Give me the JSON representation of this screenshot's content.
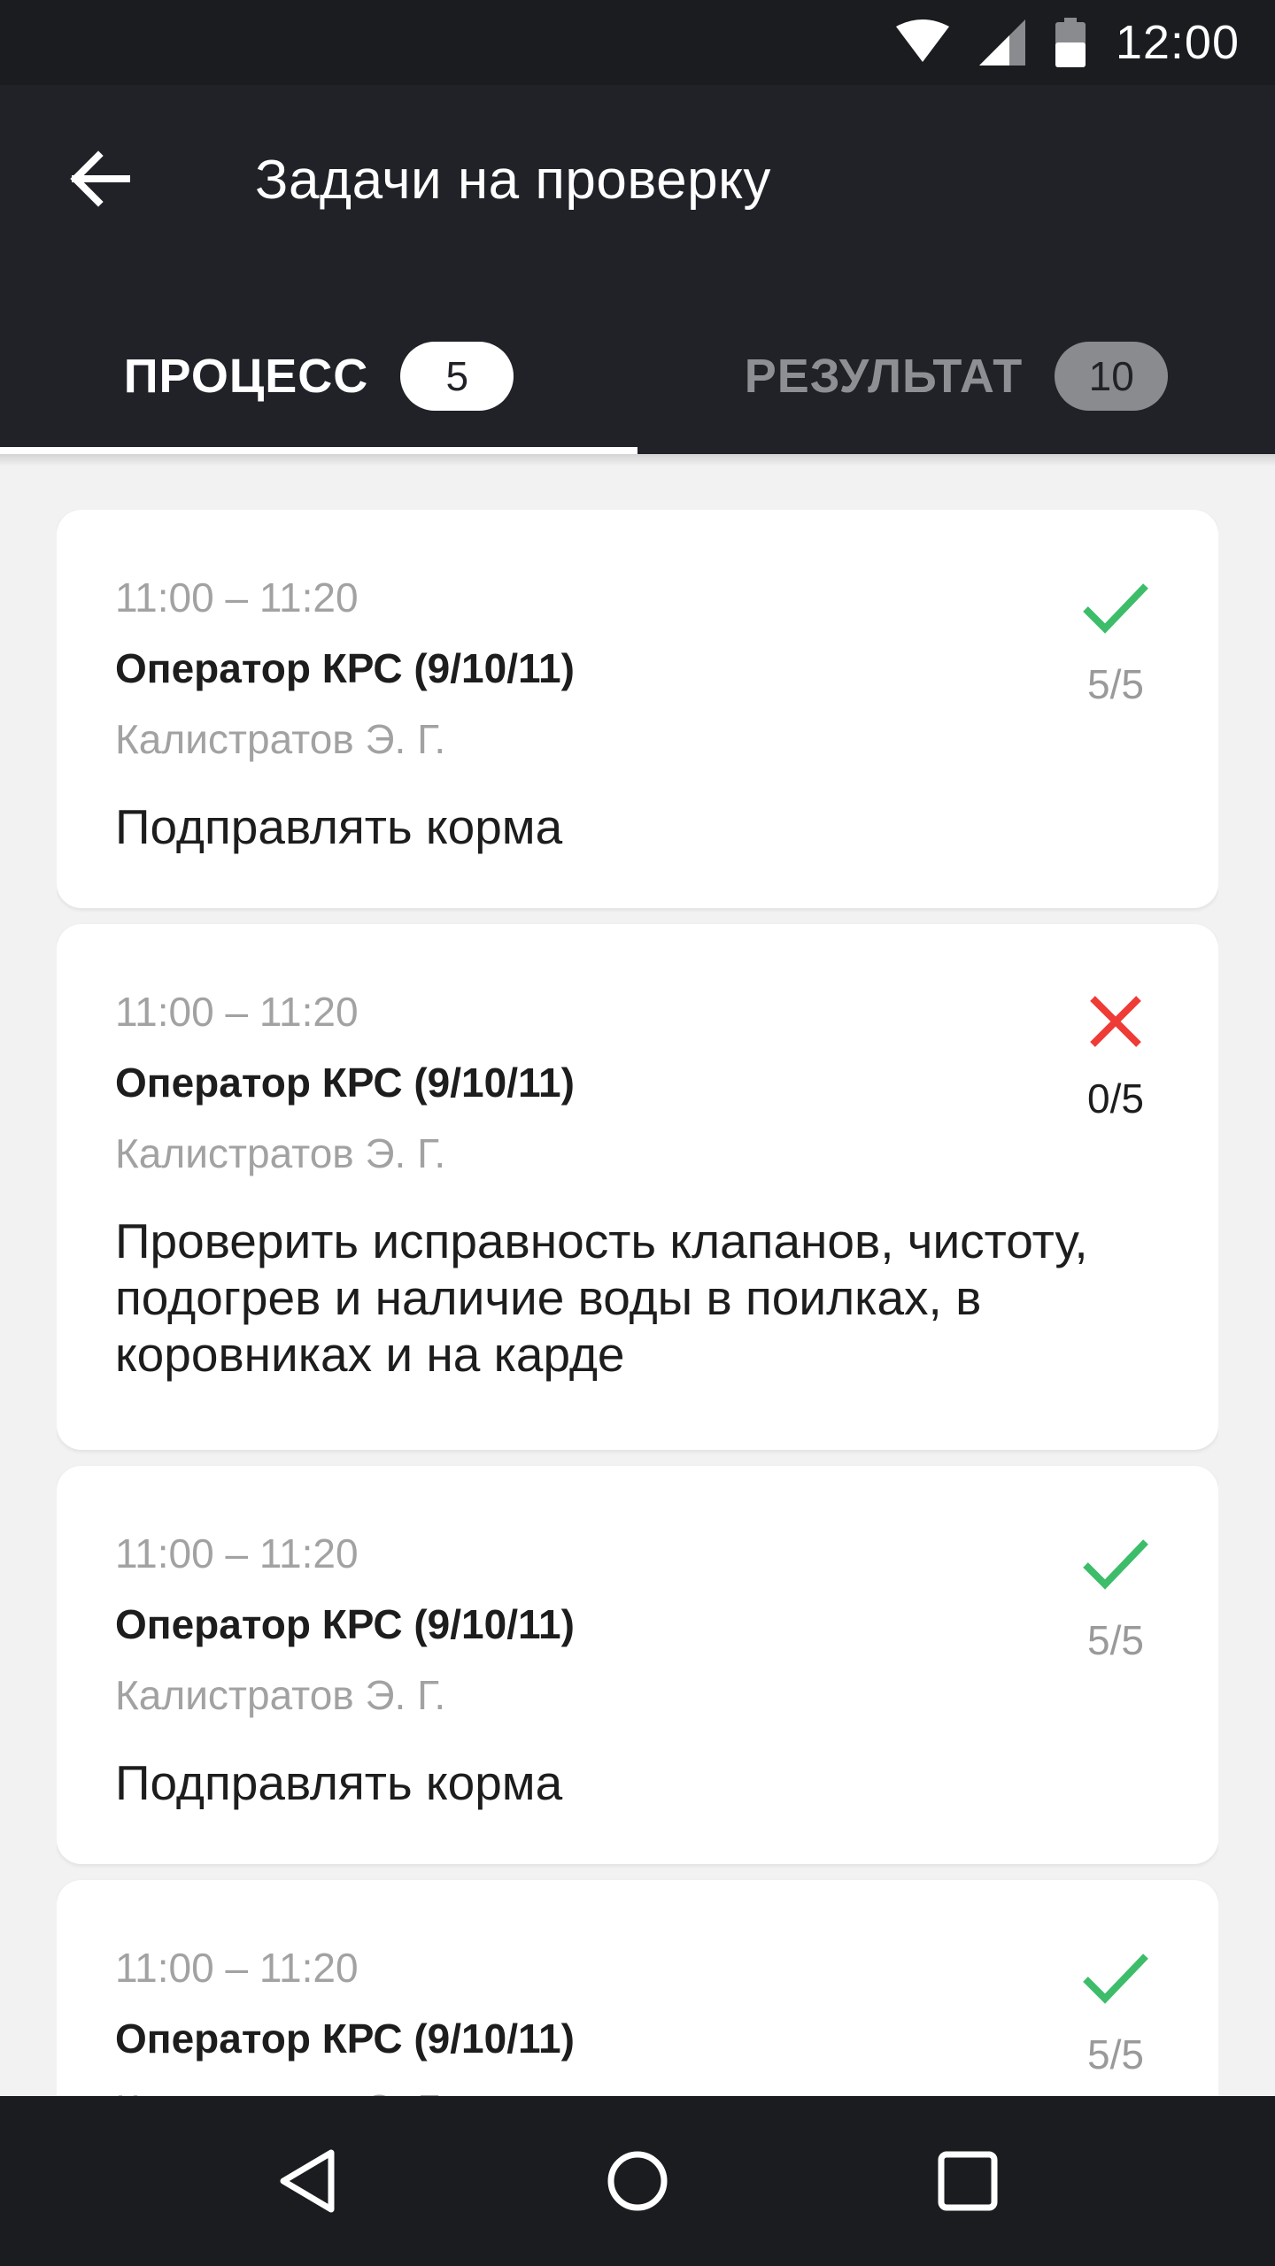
{
  "status_bar": {
    "time": "12:00",
    "icons": [
      "wifi-icon",
      "signal-icon",
      "battery-icon"
    ]
  },
  "app_bar": {
    "title": "Задачи на проверку",
    "back_icon": "arrow-left-icon"
  },
  "tabs": [
    {
      "label": "ПРОЦЕСС",
      "badge": "5",
      "active": true
    },
    {
      "label": "РЕЗУЛЬТАТ",
      "badge": "10",
      "active": false
    }
  ],
  "cards": [
    {
      "time": "11:00 – 11:20",
      "role": "Оператор КРС (9/10/11)",
      "person": "Калистратов Э. Г.",
      "task": "Подправлять корма",
      "status": "check-icon",
      "score": "5/5"
    },
    {
      "time": "11:00 – 11:20",
      "role": "Оператор КРС (9/10/11)",
      "person": "Калистратов Э. Г.",
      "task": "Проверить исправность клапанов, чистоту, подогрев и наличие воды в поилках, в коровниках и на карде",
      "status": "cross-icon",
      "score": "0/5"
    },
    {
      "time": "11:00 – 11:20",
      "role": "Оператор КРС (9/10/11)",
      "person": "Калистратов Э. Г.",
      "task": "Подправлять корма",
      "status": "check-icon",
      "score": "5/5"
    },
    {
      "time": "11:00 – 11:20",
      "role": "Оператор КРС (9/10/11)",
      "person": "Калистратов Э. Г.",
      "task": "",
      "status": "check-icon",
      "score": "5/5"
    }
  ],
  "colors": {
    "app_bar": "#202228",
    "status_bar": "#1b1c1f",
    "success": "#3dbd6a",
    "error": "#ef3b36",
    "background": "#f2f2f2"
  },
  "nav_bar": {
    "icons": [
      "back-triangle-icon",
      "home-circle-icon",
      "recents-square-icon"
    ]
  }
}
